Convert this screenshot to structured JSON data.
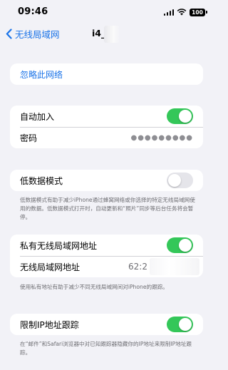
{
  "status_bar": {
    "time": "09:46",
    "battery_level": "100"
  },
  "nav": {
    "back_label": "无线局域网",
    "title": "i4_"
  },
  "forget": {
    "label": "忽略此网络"
  },
  "join_group": {
    "auto_join_label": "自动加入",
    "auto_join_on": true,
    "password_label": "密码",
    "password_value": "●●●●●●●●●"
  },
  "low_data": {
    "label": "低数据模式",
    "on": false,
    "footnote": "低数据模式有助于减少iPhone通过蜂窝网络或你选择的特定无线局域网使用的数据。低数据模式打开时，自动更新和“照片”同步等后台任务将会暂停。"
  },
  "private_address": {
    "label": "私有无线局域网地址",
    "on": true,
    "wifi_address_label": "无线局域网地址",
    "wifi_address_value": "62:2",
    "footnote": "使用私有地址有助于减少不同无线局域网间对iPhone的跟踪。"
  },
  "limit_tracking": {
    "label": "限制IP地址跟踪",
    "on": true,
    "footnote": "在“邮件”和Safari浏览器中对已知跟踪器隐藏你的IP地址来限制IP地址跟踪。"
  },
  "colors": {
    "accent": "#1a73e8",
    "toggle_on": "#34c759",
    "background": "#f2f2f7"
  }
}
